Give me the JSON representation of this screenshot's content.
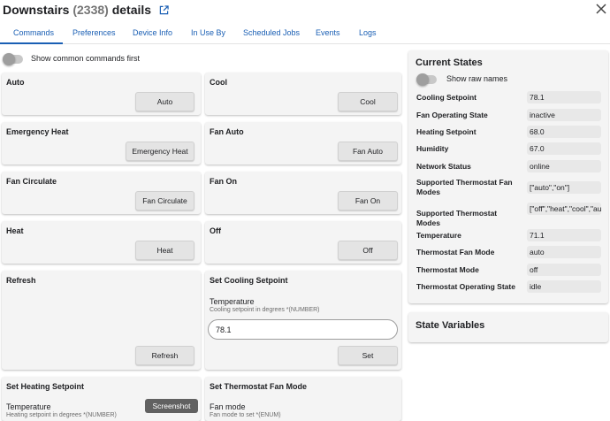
{
  "header": {
    "title": "Downstairs",
    "count": "(2338)",
    "suffix": "details"
  },
  "tabs": [
    "Commands",
    "Preferences",
    "Device Info",
    "In Use By",
    "Scheduled Jobs",
    "Events",
    "Logs"
  ],
  "show_common_label": "Show common commands first",
  "commands": {
    "auto": {
      "title": "Auto",
      "button": "Auto"
    },
    "cool": {
      "title": "Cool",
      "button": "Cool"
    },
    "emergency_heat": {
      "title": "Emergency Heat",
      "button": "Emergency Heat"
    },
    "fan_auto": {
      "title": "Fan Auto",
      "button": "Fan Auto"
    },
    "fan_circulate": {
      "title": "Fan Circulate",
      "button": "Fan Circulate"
    },
    "fan_on": {
      "title": "Fan On",
      "button": "Fan On"
    },
    "heat": {
      "title": "Heat",
      "button": "Heat"
    },
    "off": {
      "title": "Off",
      "button": "Off"
    },
    "refresh": {
      "title": "Refresh",
      "button": "Refresh"
    },
    "set_cooling": {
      "title": "Set Cooling Setpoint",
      "field_label": "Temperature",
      "field_hint": "Cooling setpoint in degrees *(NUMBER)",
      "value": "78.1",
      "button": "Set"
    },
    "set_heating": {
      "title": "Set Heating Setpoint",
      "field_label": "Temperature",
      "field_hint": "Heating setpoint in degrees *(NUMBER)"
    },
    "set_fan_mode": {
      "title": "Set Thermostat Fan Mode",
      "field_label": "Fan mode",
      "field_hint": "Fan mode to set *(ENUM)"
    }
  },
  "current_states": {
    "title": "Current States",
    "raw_names_label": "Show raw names",
    "rows": [
      {
        "name": "Cooling Setpoint",
        "value": "78.1"
      },
      {
        "name": "Fan Operating State",
        "value": "inactive"
      },
      {
        "name": "Heating Setpoint",
        "value": "68.0"
      },
      {
        "name": "Humidity",
        "value": "67.0"
      },
      {
        "name": "Network Status",
        "value": "online"
      },
      {
        "name": "Supported Thermostat Fan Modes",
        "value": "[\"auto\",\"on\"]"
      },
      {
        "name": "Supported Thermostat Modes",
        "value": "[\"off\",\"heat\",\"cool\",\"auto\"]"
      },
      {
        "name": "Temperature",
        "value": "71.1"
      },
      {
        "name": "Thermostat Fan Mode",
        "value": "auto"
      },
      {
        "name": "Thermostat Mode",
        "value": "off"
      },
      {
        "name": "Thermostat Operating State",
        "value": "idle"
      }
    ]
  },
  "state_variables": {
    "title": "State Variables"
  },
  "tooltip": "Screenshot",
  "colors": {
    "accent": "#1a5fb4",
    "card": "#f4f4f4",
    "button": "#e4e4e4"
  }
}
